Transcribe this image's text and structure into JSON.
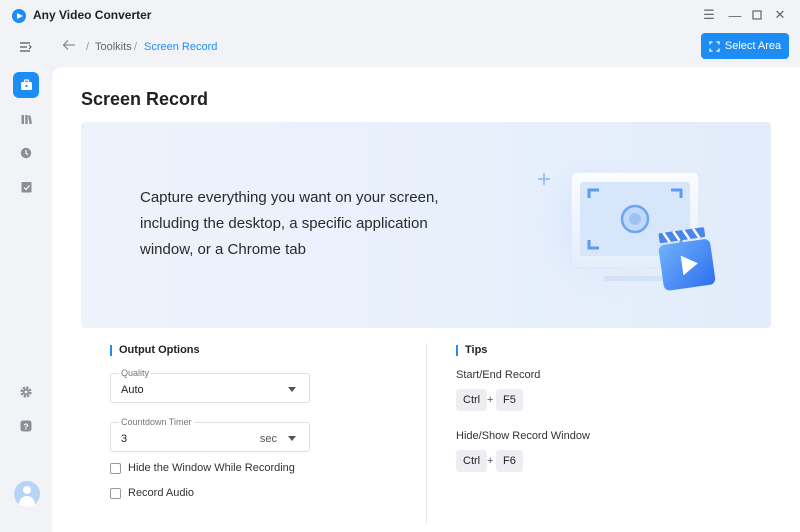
{
  "app": {
    "title": "Any Video Converter",
    "accent_color": "#1e8cf5",
    "window_controls": [
      "menu-icon",
      "minimize-icon",
      "maximize-icon",
      "close-icon"
    ]
  },
  "sidebar": {
    "items": [
      {
        "icon": "collapse-menu-icon"
      },
      {
        "icon": "toolbox-icon",
        "active": true
      },
      {
        "icon": "library-icon"
      },
      {
        "icon": "history-icon"
      },
      {
        "icon": "tasks-icon"
      },
      {
        "icon": "settings-icon"
      },
      {
        "icon": "help-icon"
      },
      {
        "icon": "avatar-icon"
      }
    ]
  },
  "header": {
    "breadcrumb": [
      "Toolkits",
      "Screen Record"
    ],
    "separator": "/",
    "select_area_label": "Select Area"
  },
  "main": {
    "title": "Screen Record",
    "banner_text": "Capture everything you want on your screen, including the desktop, a specific application window, or a Chrome tab"
  },
  "output_options": {
    "heading": "Output Options",
    "quality": {
      "label": "Quality",
      "value": "Auto"
    },
    "countdown": {
      "label": "Countdown Timer",
      "value": "3",
      "unit": "sec"
    },
    "checkboxes": [
      {
        "label": "Hide the Window While Recording",
        "checked": false
      },
      {
        "label": "Record Audio",
        "checked": false
      }
    ]
  },
  "tips": {
    "heading": "Tips",
    "items": [
      {
        "label": "Start/End Record",
        "keys": [
          "Ctrl",
          "F5"
        ]
      },
      {
        "label": "Hide/Show Record Window",
        "keys": [
          "Ctrl",
          "F6"
        ]
      }
    ],
    "plus": "+"
  }
}
